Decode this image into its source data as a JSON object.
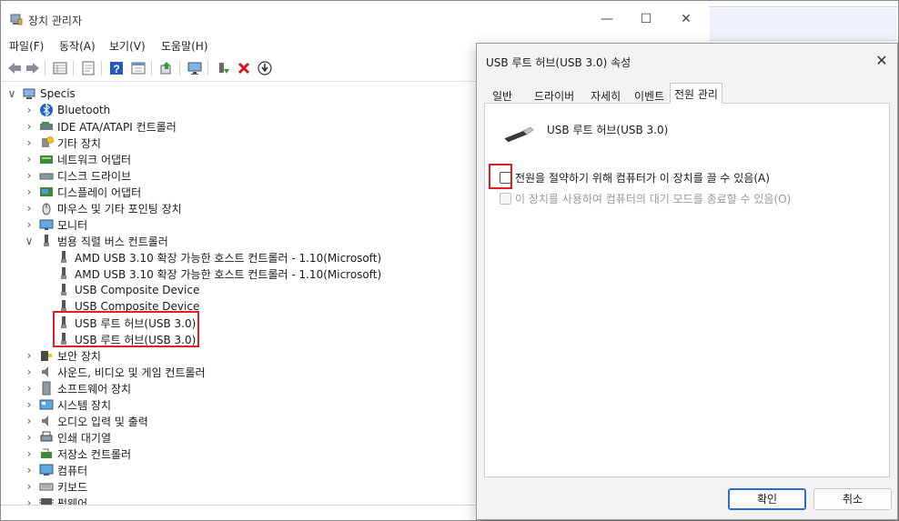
{
  "main_window": {
    "title": "장치 관리자",
    "menu": [
      "파일(F)",
      "동작(A)",
      "보기(V)",
      "도움말(H)"
    ]
  },
  "tree": {
    "root": "Specis",
    "categories": [
      {
        "label": "Bluetooth",
        "icon": "bluetooth-icon"
      },
      {
        "label": "IDE ATA/ATAPI 컨트롤러",
        "icon": "ide-controller-icon"
      },
      {
        "label": "기타 장치",
        "icon": "other-device-icon"
      },
      {
        "label": "네트워크 어댑터",
        "icon": "network-adapter-icon"
      },
      {
        "label": "디스크 드라이브",
        "icon": "disk-drive-icon"
      },
      {
        "label": "디스플레이 어댑터",
        "icon": "display-adapter-icon"
      },
      {
        "label": "마우스 및 기타 포인팅 장치",
        "icon": "mouse-icon"
      },
      {
        "label": "모니터",
        "icon": "monitor-icon"
      }
    ],
    "usb_category": "범용 직렬 버스 컨트롤러",
    "usb_children": [
      "AMD USB 3.10 확장 가능한 호스트 컨트롤러 - 1.10(Microsoft)",
      "AMD USB 3.10 확장 가능한 호스트 컨트롤러 - 1.10(Microsoft)",
      "USB Composite Device",
      "USB Composite Device",
      "USB 루트 허브(USB 3.0)",
      "USB 루트 허브(USB 3.0)"
    ],
    "categories_after": [
      {
        "label": "보안 장치",
        "icon": "security-device-icon"
      },
      {
        "label": "사운드, 비디오 및 게임 컨트롤러",
        "icon": "sound-icon"
      },
      {
        "label": "소프트웨어 장치",
        "icon": "software-device-icon"
      },
      {
        "label": "시스템 장치",
        "icon": "system-device-icon"
      },
      {
        "label": "오디오 입력 및 출력",
        "icon": "audio-icon"
      },
      {
        "label": "인쇄 대기열",
        "icon": "printer-icon"
      },
      {
        "label": "저장소 컨트롤러",
        "icon": "storage-controller-icon"
      },
      {
        "label": "컴퓨터",
        "icon": "computer-icon"
      },
      {
        "label": "키보드",
        "icon": "keyboard-icon"
      },
      {
        "label": "펌웨어",
        "icon": "firmware-icon"
      }
    ]
  },
  "dialog": {
    "title": "USB 루트 허브(USB 3.0) 속성",
    "tabs": [
      "일반",
      "드라이버",
      "자세히",
      "이벤트",
      "전원 관리"
    ],
    "active_tab": "전원 관리",
    "device_name": "USB 루트 허브(USB 3.0)",
    "option_allow_off": "전원을 절약하기 위해 컴퓨터가 이 장치를 끌 수 있음(A)",
    "option_allow_wake": "이 장치를 사용하여 컴퓨터의 대기 모드를 종료할 수 있음(O)",
    "ok": "확인",
    "cancel": "취소"
  },
  "colors": {
    "highlight_box": "#e02020",
    "accent": "#2a6bd6"
  }
}
